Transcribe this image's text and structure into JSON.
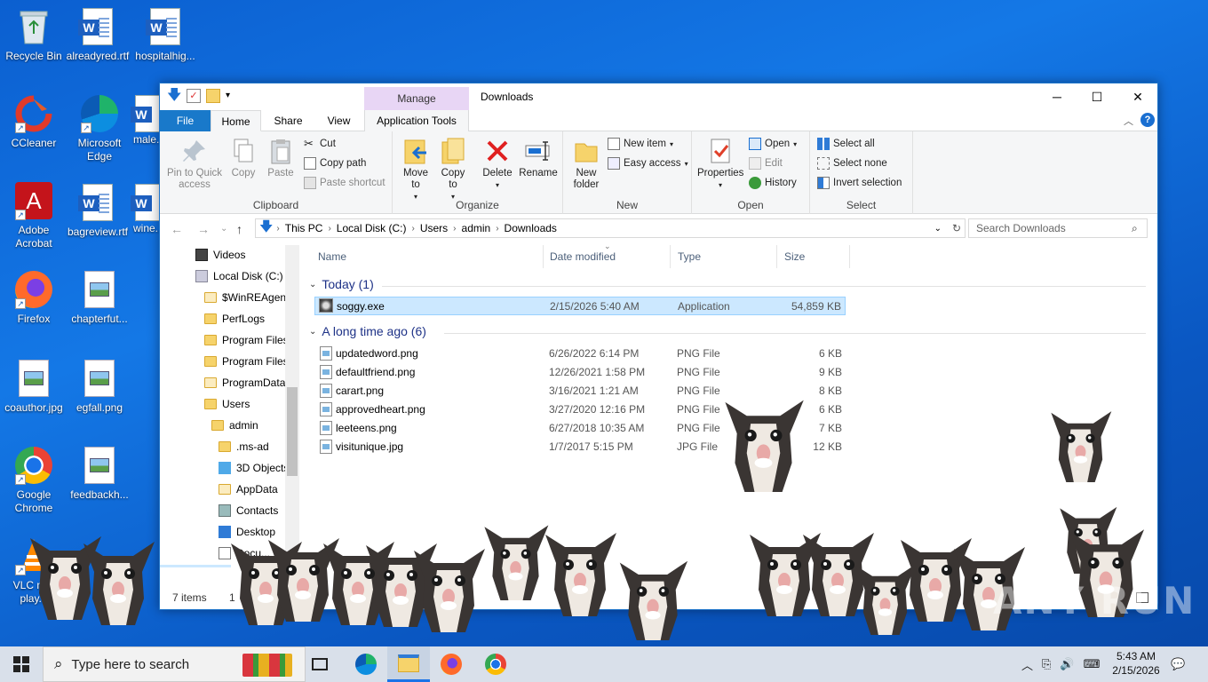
{
  "desktop": {
    "icons": [
      {
        "label": "Recycle Bin"
      },
      {
        "label": "alreadyred.rtf"
      },
      {
        "label": "hospitalhig..."
      },
      {
        "label": "CCleaner"
      },
      {
        "label": "Microsoft Edge"
      },
      {
        "label": "male..."
      },
      {
        "label": "Adobe Acrobat"
      },
      {
        "label": "bagreview.rtf"
      },
      {
        "label": "wine..."
      },
      {
        "label": "Firefox"
      },
      {
        "label": "chapterfut..."
      },
      {
        "label": "coauthor.jpg"
      },
      {
        "label": "egfall.png"
      },
      {
        "label": "Google Chrome"
      },
      {
        "label": "feedbackh..."
      },
      {
        "label": "VLC m... play..."
      }
    ]
  },
  "window": {
    "title": "Downloads",
    "manage_tab": "Manage",
    "tabs": {
      "file": "File",
      "home": "Home",
      "share": "Share",
      "view": "View",
      "app_tools": "Application Tools"
    },
    "ribbon": {
      "clipboard": {
        "label": "Clipboard",
        "pin": "Pin to Quick access",
        "copy": "Copy",
        "paste": "Paste",
        "cut": "Cut",
        "copy_path": "Copy path",
        "paste_shortcut": "Paste shortcut"
      },
      "organize": {
        "label": "Organize",
        "move_to": "Move to",
        "copy_to": "Copy to",
        "delete": "Delete",
        "rename": "Rename"
      },
      "new": {
        "label": "New",
        "new_folder": "New folder",
        "new_item": "New item",
        "easy_access": "Easy access"
      },
      "open": {
        "label": "Open",
        "properties": "Properties",
        "open": "Open",
        "edit": "Edit",
        "history": "History"
      },
      "select": {
        "label": "Select",
        "select_all": "Select all",
        "select_none": "Select none",
        "invert": "Invert selection"
      }
    },
    "address": {
      "crumbs": [
        "This PC",
        "Local Disk (C:)",
        "Users",
        "admin",
        "Downloads"
      ]
    },
    "search_placeholder": "Search Downloads",
    "nav": [
      {
        "label": "Videos"
      },
      {
        "label": "Local Disk (C:)"
      },
      {
        "label": "$WinREAgent"
      },
      {
        "label": "PerfLogs"
      },
      {
        "label": "Program Files"
      },
      {
        "label": "Program Files"
      },
      {
        "label": "ProgramData"
      },
      {
        "label": "Users"
      },
      {
        "label": "admin"
      },
      {
        "label": ".ms-ad"
      },
      {
        "label": "3D Objects"
      },
      {
        "label": "AppData"
      },
      {
        "label": "Contacts"
      },
      {
        "label": "Desktop"
      },
      {
        "label": "Docu..."
      }
    ],
    "columns": {
      "name": "Name",
      "date": "Date modified",
      "type": "Type",
      "size": "Size"
    },
    "groups": {
      "today": "Today (1)",
      "long_ago": "A long time ago (6)"
    },
    "files_today": [
      {
        "name": "soggy.exe",
        "date": "2/15/2026 5:40 AM",
        "type": "Application",
        "size": "54,859 KB"
      }
    ],
    "files_old": [
      {
        "name": "updatedword.png",
        "date": "6/26/2022 6:14 PM",
        "type": "PNG File",
        "size": "6 KB"
      },
      {
        "name": "defaultfriend.png",
        "date": "12/26/2021 1:58 PM",
        "type": "PNG File",
        "size": "9 KB"
      },
      {
        "name": "carart.png",
        "date": "3/16/2021 1:21 AM",
        "type": "PNG File",
        "size": "8 KB"
      },
      {
        "name": "approvedheart.png",
        "date": "3/27/2020 12:16 PM",
        "type": "PNG File",
        "size": "6 KB"
      },
      {
        "name": "leeteens.png",
        "date": "6/27/2018 10:35 AM",
        "type": "PNG File",
        "size": "7 KB"
      },
      {
        "name": "visitunique.jpg",
        "date": "1/7/2017 5:15 PM",
        "type": "JPG File",
        "size": "12 KB"
      }
    ],
    "status": {
      "items": "7 items",
      "extra": "1"
    }
  },
  "taskbar": {
    "search_placeholder": "Type here to search",
    "time": "5:43 AM",
    "date": "2/15/2026"
  },
  "watermark": "ANY RUN",
  "colors": {
    "accent": "#1979ca",
    "selection": "#cce8ff",
    "manage_tab": "#e8d6f5"
  }
}
